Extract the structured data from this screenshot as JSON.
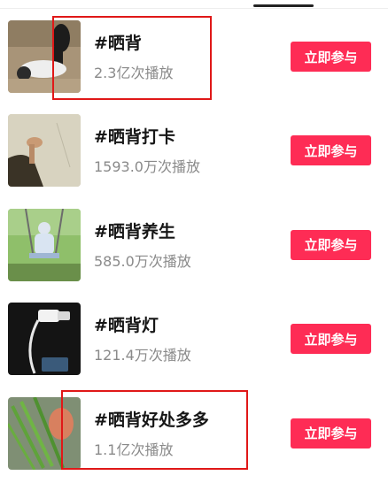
{
  "topics": [
    {
      "title": "#晒背",
      "plays": "2.3亿次播放",
      "button": "立即参与",
      "thumb": "person-lying-on-ground"
    },
    {
      "title": "#晒背打卡",
      "plays": "1593.0万次播放",
      "button": "立即参与",
      "thumb": "hand-near-wall"
    },
    {
      "title": "#晒背养生",
      "plays": "585.0万次播放",
      "button": "立即参与",
      "thumb": "person-on-swing"
    },
    {
      "title": "#晒背灯",
      "plays": "121.4万次播放",
      "button": "立即参与",
      "thumb": "heat-lamp"
    },
    {
      "title": "#晒背好处多多",
      "plays": "1.1亿次播放",
      "button": "立即参与",
      "thumb": "green-vegetables"
    }
  ],
  "colors": {
    "button_bg": "#fe2c55",
    "highlight": "#e01818",
    "title": "#161616",
    "plays": "#8a8a8a"
  }
}
